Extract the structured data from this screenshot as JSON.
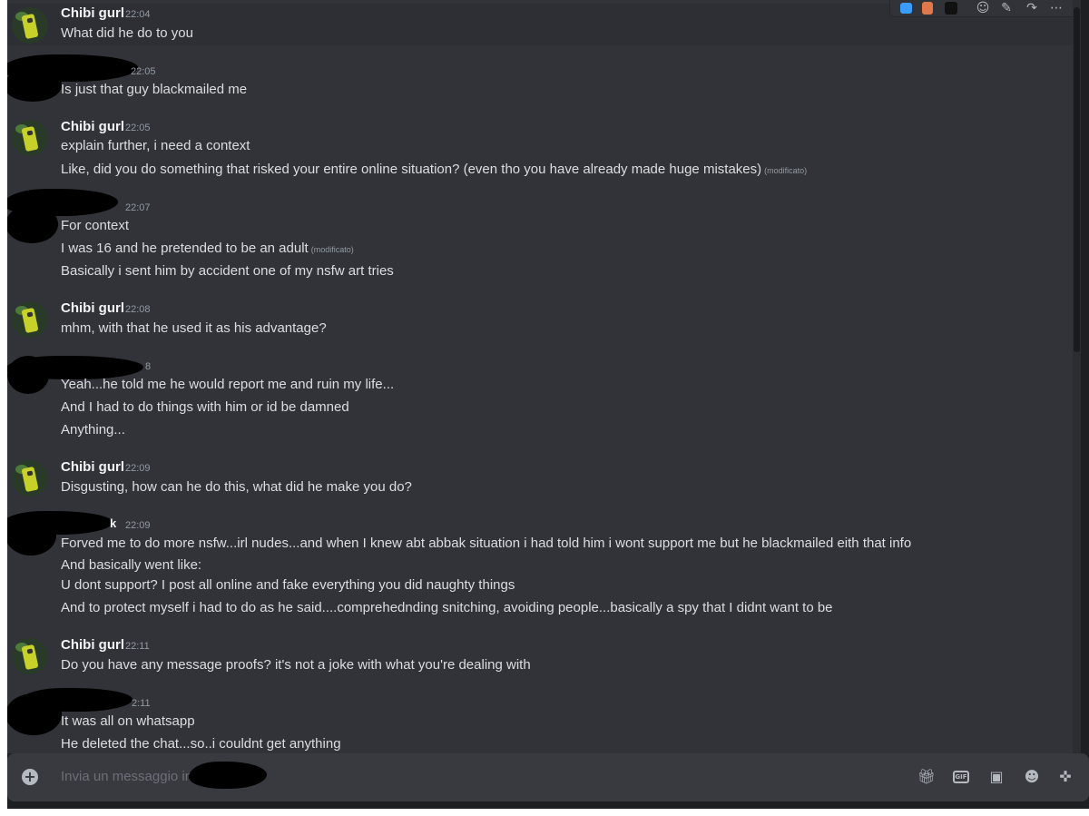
{
  "messages": [
    {
      "author": "Chibi gurl",
      "time": "22:04",
      "lines": [
        "What did he do to you"
      ]
    },
    {
      "author": "",
      "time": "22:05",
      "lines": [
        "Is just that guy blackmailed me"
      ]
    },
    {
      "author": "Chibi gurl",
      "time": "22:05",
      "lines": [
        "explain further, i need a context",
        "Like, did you do something that risked your entire online situation? (even tho you have already made huge mistakes)"
      ]
    },
    {
      "author": "",
      "time": "22:07",
      "lines": [
        "For context",
        "I was 16 and he pretended to be an adult",
        "Basically i sent him by accident one of my nsfw art tries"
      ]
    },
    {
      "author": "Chibi gurl",
      "time": "22:08",
      "lines": [
        "mhm, with that he used it as his advantage?"
      ]
    },
    {
      "author": "",
      "time": "8",
      "lines": [
        "Yeah...he told me he would report me and ruin my life...",
        "And I had to do things with him or id be damned",
        "Anything..."
      ]
    },
    {
      "author": "Chibi gurl",
      "time": "22:09",
      "lines": [
        "Disgusting, how can he do this, what did he make you do?"
      ]
    },
    {
      "author": "k",
      "time": "22:09",
      "lines": [
        "Forved me to do more nsfw...irl nudes...and when I knew abt abbak situation i had told him i wont support me but he blackmailed eith that info",
        "And basically went like:",
        "U dont support? I post all online and fake everything you did naughty things",
        "And to protect myself i had to do as he said....comprehednding snitching, avoiding people...basically a spy that I didnt want to be"
      ]
    },
    {
      "author": "Chibi gurl",
      "time": "22:11",
      "lines": [
        "Do you have any message proofs? it's not a joke with what you're dealing with"
      ]
    },
    {
      "author": "",
      "time": "2:11",
      "lines": [
        "It was all on whatsapp",
        "He deleted the chat...so..i couldnt get anything"
      ]
    }
  ],
  "edited_label": "(modificato)",
  "composer": {
    "placeholder": "Invia un messaggio in"
  },
  "toolbar_icons": [
    "app-icon-blue",
    "app-icon-orange",
    "app-icon-dark",
    "add-reaction-icon",
    "edit-icon",
    "forward-icon",
    "more-icon"
  ],
  "composer_icons": [
    "add-attachment-icon",
    "gift-icon",
    "gif-icon",
    "sticker-icon",
    "emoji-icon",
    "activities-icon"
  ],
  "colors": {
    "chat_bg": "#313338",
    "composer_bg": "#383a40",
    "text": "#dbdee1",
    "muted": "#949ba4"
  }
}
